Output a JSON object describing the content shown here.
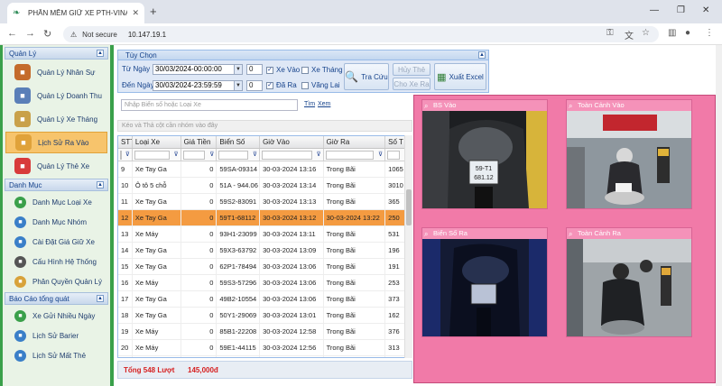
{
  "browser": {
    "tab_title": "PHẦN MỀM GIỮ XE PTH-VINA",
    "not_secure": "Not secure",
    "url": "10.147.19.1"
  },
  "sidebar": {
    "section1": "Quản Lý",
    "items1": [
      {
        "label": "Quản Lý Nhân Sự",
        "icon": "users-icon",
        "color": "#c46b2b"
      },
      {
        "label": "Quản Lý Doanh Thu",
        "icon": "revenue-icon",
        "color": "#5a7fb8"
      },
      {
        "label": "Quản Lý Xe Tháng",
        "icon": "house-icon",
        "color": "#c9a14a"
      },
      {
        "label": "Lịch Sử Ra Vào",
        "icon": "log-icon",
        "color": "#e0a23a"
      },
      {
        "label": "Quản Lý Thẻ Xe",
        "icon": "card-icon",
        "color": "#d83b3b"
      }
    ],
    "section2": "Danh Mục",
    "items2": [
      {
        "label": "Danh Mục Loại Xe",
        "icon": "car-type-icon",
        "color": "#3aa04a"
      },
      {
        "label": "Danh Mục Nhóm",
        "icon": "group-icon",
        "color": "#3a7fc8"
      },
      {
        "label": "Cài Đặt Giá Giữ Xe",
        "icon": "price-icon",
        "color": "#3a7fc8"
      },
      {
        "label": "Cấu Hình Hệ Thống",
        "icon": "gear-icon",
        "color": "#555555"
      },
      {
        "label": "Phân Quyền Quản Lý",
        "icon": "lock-icon",
        "color": "#d8a23a"
      }
    ],
    "section3": "Báo Cáo tổng quát",
    "items3": [
      {
        "label": "Xe Gửi Nhiều Ngày",
        "icon": "days-icon",
        "color": "#3aa04a"
      },
      {
        "label": "Lịch Sử Barier",
        "icon": "barrier-icon",
        "color": "#3a7fc8"
      },
      {
        "label": "Lịch Sử Mất Thẻ",
        "icon": "lost-card-icon",
        "color": "#3a7fc8"
      }
    ]
  },
  "options": {
    "title": "Tùy Chọn",
    "from_label": "Từ Ngày :",
    "from_value": "30/03/2024-00:00:00",
    "to_label": "Đến Ngày:",
    "to_value": "30/03/2024-23:59:59",
    "from_spin": "0",
    "to_spin": "0",
    "chk_xe_vao": "Xe Vào",
    "chk_da_ra": "Đã Ra",
    "chk_xe_thang": "Xe Tháng",
    "chk_vang_lai": "Vãng Lai",
    "btn_search": "Tra Cứu",
    "btn_cancel_card": "Hủy Thẻ",
    "btn_checkout": "Cho Xe Ra",
    "btn_excel": "Xuất Excel"
  },
  "search": {
    "placeholder": "Nhập Biển số hoặc Loại Xe",
    "find": "Tìm",
    "view": "Xem"
  },
  "group_hint": "Kéo và Thả cột cần nhóm vào đây",
  "grid": {
    "headers": [
      "STT",
      "Loại Xe",
      "Giá Tiền",
      "Biển Số",
      "Giờ Vào",
      "Giờ Ra",
      "Số T"
    ],
    "rows": [
      [
        "9",
        "Xe Tay Ga",
        "0",
        "59SA-09314",
        "30-03-2024 13:16",
        "Trong Bãi",
        "1065"
      ],
      [
        "10",
        "Ô tô 5 chỗ",
        "0",
        "51A - 944.06",
        "30-03-2024 13:14",
        "Trong Bãi",
        "3010"
      ],
      [
        "11",
        "Xe Tay Ga",
        "0",
        "59S2-83091",
        "30-03-2024 13:13",
        "Trong Bãi",
        "365"
      ],
      [
        "12",
        "Xe Tay Ga",
        "0",
        "59T1-68112",
        "30-03-2024 13:12",
        "30-03-2024 13:22",
        "250"
      ],
      [
        "13",
        "Xe Máy",
        "0",
        "93H1-23099",
        "30-03-2024 13:11",
        "Trong Bãi",
        "531"
      ],
      [
        "14",
        "Xe Tay Ga",
        "0",
        "59X3-63792",
        "30-03-2024 13:09",
        "Trong Bãi",
        "196"
      ],
      [
        "15",
        "Xe Tay Ga",
        "0",
        "62P1-78494",
        "30-03-2024 13:06",
        "Trong Bãi",
        "191"
      ],
      [
        "16",
        "Xe Máy",
        "0",
        "59S3-57296",
        "30-03-2024 13:06",
        "Trong Bãi",
        "253"
      ],
      [
        "17",
        "Xe Tay Ga",
        "0",
        "49B2-10554",
        "30-03-2024 13:06",
        "Trong Bãi",
        "373"
      ],
      [
        "18",
        "Xe Tay Ga",
        "0",
        "50Y1-29069",
        "30-03-2024 13:01",
        "Trong Bãi",
        "162"
      ],
      [
        "19",
        "Xe Máy",
        "0",
        "85B1-22208",
        "30-03-2024 12:58",
        "Trong Bãi",
        "376"
      ],
      [
        "20",
        "Xe Máy",
        "0",
        "59E1-44115",
        "30-03-2024 12:56",
        "Trong Bãi",
        "313"
      ],
      [
        "21",
        "Xe Máy",
        "0",
        "64F1-21240",
        "30-03-2024 12:55",
        "Trong Bãi",
        "207"
      ]
    ],
    "selected_index": 3
  },
  "footer": {
    "total": "Tổng 548 Lượt",
    "amount": "145,000đ"
  },
  "cameras": {
    "bs_vao": "BS Vào",
    "toan_canh_vao": "Toàn Cảnh Vào",
    "bien_so_ra": "Biển Số Ra",
    "toan_canh_ra": "Toàn Cảnh Ra",
    "plate_text_1": "59-T1",
    "plate_text_2": "681.12"
  }
}
